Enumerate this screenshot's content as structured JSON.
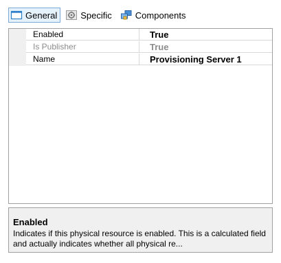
{
  "tabs": [
    {
      "label": "General",
      "icon": "window-icon",
      "active": true
    },
    {
      "label": "Specific",
      "icon": "gear-icon",
      "active": false
    },
    {
      "label": "Components",
      "icon": "components-icon",
      "active": false
    }
  ],
  "properties": [
    {
      "name": "Enabled",
      "value": "True",
      "disabled": false
    },
    {
      "name": "Is Publisher",
      "value": "True",
      "disabled": true
    },
    {
      "name": "Name",
      "value": "Provisioning Server 1",
      "disabled": false
    }
  ],
  "description": {
    "title": "Enabled",
    "text": "Indicates if this physical resource is enabled. This is a calculated field and actually indicates whether all physical re..."
  },
  "colors": {
    "active_tab_border": "#7aa7d6",
    "active_tab_background": "#e5f1fb",
    "disabled_text": "#8c8c8c",
    "gutter": "#f0f0f0"
  }
}
